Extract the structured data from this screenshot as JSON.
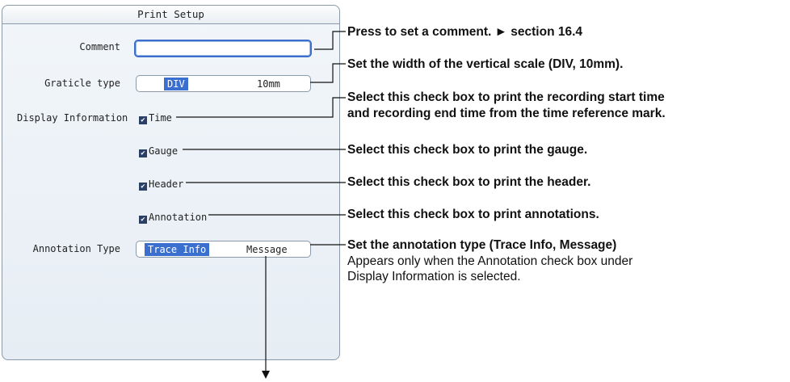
{
  "dialog": {
    "title": "Print Setup",
    "comment": {
      "label": "Comment",
      "value": ""
    },
    "graticule": {
      "label": "Graticle type",
      "options": [
        "DIV",
        "10mm"
      ],
      "selected": "DIV"
    },
    "display_info": {
      "label": "Display Information",
      "items": [
        {
          "label": "Time",
          "checked": true
        },
        {
          "label": "Gauge",
          "checked": true
        },
        {
          "label": "Header",
          "checked": true
        },
        {
          "label": "Annotation",
          "checked": true
        }
      ]
    },
    "annotation_type": {
      "label": "Annotation Type",
      "options": [
        "Trace Info",
        "Message"
      ],
      "selected": "Trace Info"
    }
  },
  "callouts": {
    "comment": "Press to set a comment. ► section 16.4",
    "graticule": "Set the width of the vertical scale (DIV, 10mm).",
    "time_line1": "Select this check box to print the recording start time",
    "time_line2": "and recording end time from the time reference mark.",
    "gauge": "Select this check box to print the gauge.",
    "header": "Select this check box to print the header.",
    "annotation": "Select this check box to print annotations.",
    "annotation_type": "Set the annotation type (Trace Info, Message)",
    "annotation_type_note1": "Appears only when the Annotation check box under",
    "annotation_type_note2": "Display Information is selected."
  },
  "colors": {
    "selection": "#3a6fcf",
    "focus_border": "#3c6fcc",
    "panel_border": "#8a9aaa"
  }
}
